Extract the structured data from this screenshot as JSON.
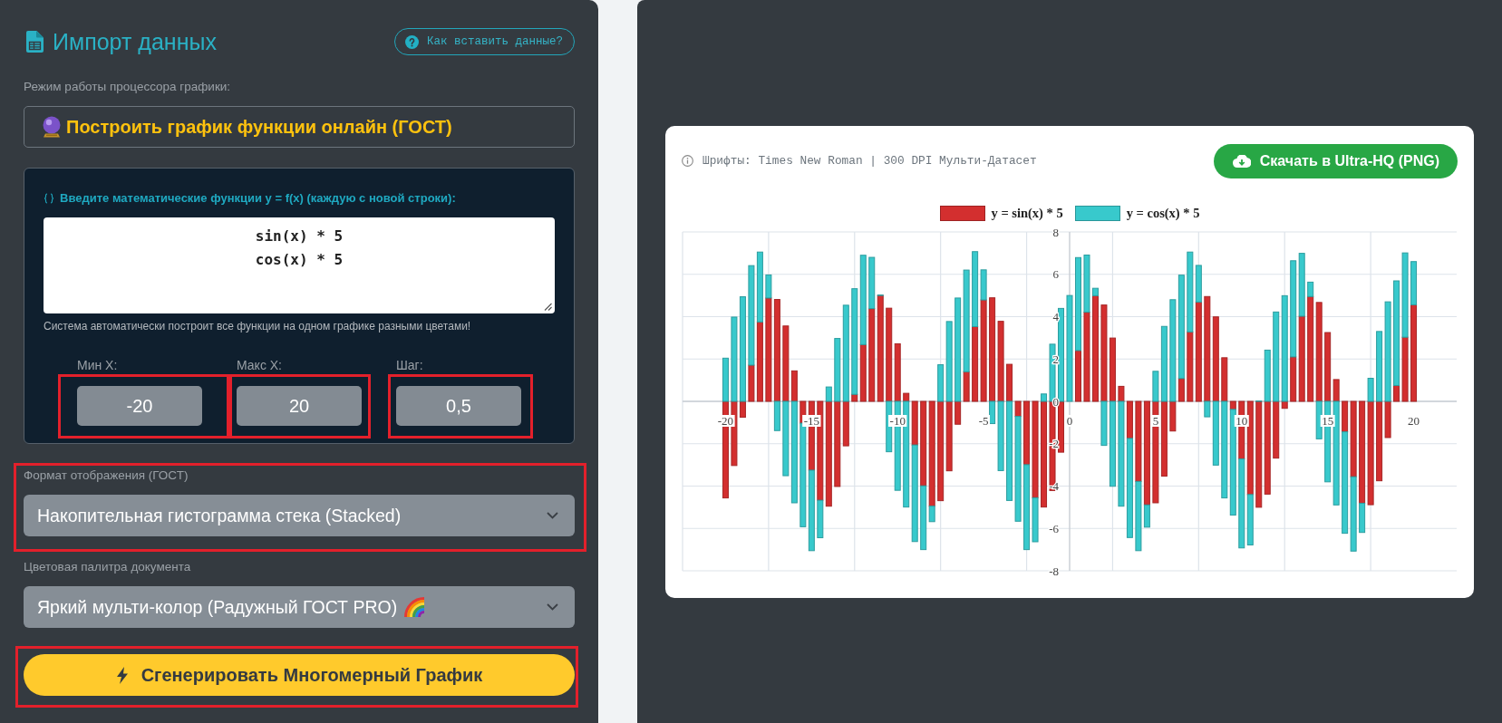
{
  "panel": {
    "title": "Импорт данных",
    "help_button": "Как вставить данные?",
    "mode": {
      "label": "Режим работы процессора графики:",
      "value": "Построить график функции онлайн (ГОСТ)"
    },
    "functions": {
      "label": "Введите математические функции y = f(x) (каждую с новой строки):",
      "lines": [
        "sin(x) * 5",
        "cos(x) * 5"
      ],
      "hint": "Система автоматически построит все функции на одном графике разными цветами!"
    },
    "range": [
      {
        "label": "Мин X:",
        "value": "-20",
        "highlighted": true
      },
      {
        "label": "Макс X:",
        "value": "20",
        "highlighted": true
      },
      {
        "label": "Шаг:",
        "value": "0,5",
        "highlighted": true
      }
    ],
    "selects": [
      {
        "label": "Формат отображения (ГОСТ)",
        "value": "Накопительная гистограмма стека (Stacked)",
        "highlighted": true
      },
      {
        "label": "Цветовая палитра документа",
        "value": "Яркий мульти-колор (Радужный ГОСТ PRO)",
        "highlighted": false
      }
    ],
    "generate_button": {
      "label": "Сгенерировать Многомерный График",
      "highlighted": true
    }
  },
  "preview": {
    "info": "Шрифты: Times New Roman | 300 DPI Мульти-Датасет",
    "download_button": "Скачать в Ultra-HQ (PNG)",
    "chart_data": {
      "type": "bar",
      "stacked": true,
      "grid": true,
      "legend": "top",
      "x": [
        -20,
        -19.5,
        -19,
        -18.5,
        -18,
        -17.5,
        -17,
        -16.5,
        -16,
        -15.5,
        -15,
        -14.5,
        -14,
        -13.5,
        -13,
        -12.5,
        -12,
        -11.5,
        -11,
        -10.5,
        -10,
        -9.5,
        -9,
        -8.5,
        -8,
        -7.5,
        -7,
        -6.5,
        -6,
        -5.5,
        -5,
        -4.5,
        -4,
        -3.5,
        -3,
        -2.5,
        -2,
        -1.5,
        -1,
        -0.5,
        0,
        0.5,
        1,
        1.5,
        2,
        2.5,
        3,
        3.5,
        4,
        4.5,
        5,
        5.5,
        6,
        6.5,
        7,
        7.5,
        8,
        8.5,
        9,
        9.5,
        10,
        10.5,
        11,
        11.5,
        12,
        12.5,
        13,
        13.5,
        14,
        14.5,
        15,
        15.5,
        16,
        16.5,
        17,
        17.5,
        18,
        18.5,
        19,
        19.5,
        20
      ],
      "xlim": [
        -22.5,
        22.5
      ],
      "ylim": [
        -8,
        8
      ],
      "xticks": [
        -20,
        -15,
        -10,
        -5,
        0,
        5,
        10,
        15,
        20
      ],
      "yticks": [
        -8,
        -6,
        -4,
        -2,
        0,
        2,
        4,
        6,
        8
      ],
      "series": [
        {
          "name": "y = sin(x) * 5",
          "color": "#d32f2f",
          "values": [
            -4.56,
            -3.03,
            -0.75,
            1.71,
            3.75,
            4.88,
            4.81,
            3.56,
            1.44,
            -1.03,
            -3.25,
            -4.67,
            -4.95,
            -4.02,
            -2.1,
            0.33,
            2.68,
            4.38,
            5,
            4.4,
            2.72,
            0.38,
            -2.06,
            -3.99,
            -4.95,
            -4.69,
            -3.28,
            -1.08,
            1.4,
            3.53,
            4.79,
            4.89,
            3.78,
            1.75,
            -0.71,
            -2.99,
            -4.55,
            -4.99,
            -4.21,
            -2.4,
            0,
            2.4,
            4.21,
            4.99,
            4.55,
            2.99,
            0.71,
            -1.75,
            -3.78,
            -4.89,
            -4.79,
            -3.53,
            -1.4,
            1.08,
            3.28,
            4.69,
            4.95,
            3.99,
            2.06,
            -0.38,
            -2.72,
            -4.4,
            -5,
            -4.38,
            -2.68,
            -0.33,
            2.1,
            4.02,
            4.95,
            4.67,
            3.25,
            1.03,
            -1.44,
            -3.56,
            -4.81,
            -4.88,
            -3.75,
            -1.71,
            0.75,
            3.03,
            4.56
          ]
        },
        {
          "name": "y = cos(x) * 5",
          "color": "#38c9cc",
          "values": [
            2.04,
            3.98,
            4.94,
            4.7,
            3.3,
            1.09,
            -1.38,
            -3.51,
            -4.79,
            -4.89,
            -3.8,
            -1.77,
            0.68,
            2.97,
            4.54,
            4.99,
            4.22,
            2.42,
            0.02,
            -2.38,
            -4.2,
            -4.99,
            -4.56,
            -3.01,
            -0.73,
            1.73,
            3.77,
            4.88,
            4.8,
            3.54,
            1.42,
            -1.05,
            -3.27,
            -4.68,
            -4.95,
            -4.01,
            -2.08,
            0.35,
            2.7,
            4.39,
            5,
            4.39,
            2.7,
            0.35,
            -2.08,
            -4.01,
            -4.95,
            -4.68,
            -3.27,
            -1.05,
            1.42,
            3.54,
            4.8,
            4.88,
            3.77,
            1.73,
            -0.73,
            -3.01,
            -4.56,
            -4.99,
            -4.2,
            -2.38,
            0.02,
            2.42,
            4.22,
            4.99,
            4.54,
            2.97,
            0.68,
            -1.77,
            -3.8,
            -4.89,
            -4.79,
            -3.51,
            -1.38,
            1.09,
            3.3,
            4.7,
            4.94,
            3.98,
            2.04
          ]
        }
      ]
    }
  }
}
